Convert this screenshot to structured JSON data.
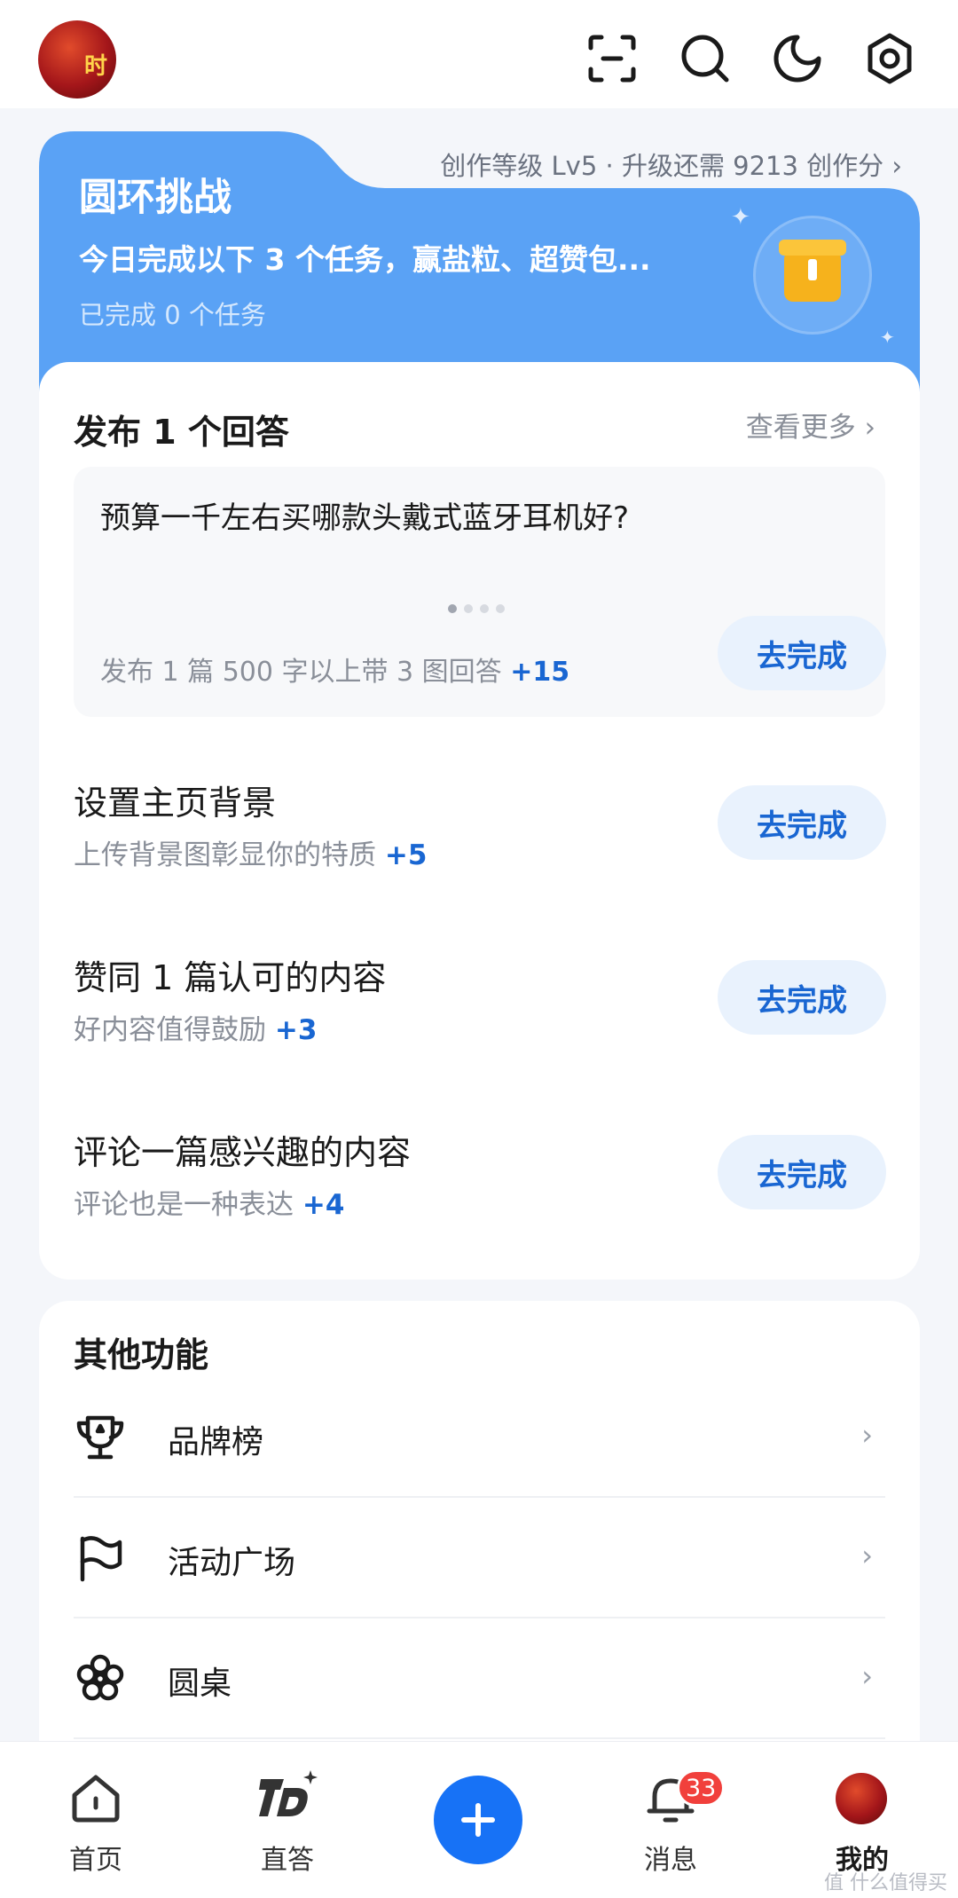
{
  "colors": {
    "brand_blue": "#1772f6",
    "challenge_blue": "#5aa2f5",
    "bonus_blue": "#1966d2",
    "badge_red": "#f1403c"
  },
  "topbar": {
    "avatar_text": "时",
    "icons": [
      "scan-icon",
      "search-icon",
      "moon-icon",
      "settings-icon"
    ]
  },
  "challenge": {
    "title": "圆环挑战",
    "level_text": "创作等级 Lv5 · 升级还需 9213 创作分 ›",
    "description": "今日完成以下 3 个任务，赢盐粒、超赞包...",
    "progress": "已完成 0 个任务"
  },
  "tasks": {
    "section_title": "发布 1 个回答",
    "see_more": "查看更多 ›",
    "question": {
      "text": "预算一千左右买哪款头戴式蓝牙耳机好?",
      "sub": "发布 1 篇 500 字以上带 3 图回答 ",
      "bonus": "+15",
      "button": "去完成"
    },
    "items": [
      {
        "title": "设置主页背景",
        "sub": "上传背景图彰显你的特质 ",
        "bonus": "+5",
        "button": "去完成"
      },
      {
        "title": "赞同 1 篇认可的内容",
        "sub": "好内容值得鼓励 ",
        "bonus": "+3",
        "button": "去完成"
      },
      {
        "title": "评论一篇感兴趣的内容",
        "sub": "评论也是一种表达 ",
        "bonus": "+4",
        "button": "去完成"
      }
    ]
  },
  "other": {
    "title": "其他功能",
    "rows": [
      {
        "label": "品牌榜",
        "icon": "trophy-icon"
      },
      {
        "label": "活动广场",
        "icon": "flag-icon"
      },
      {
        "label": "圆桌",
        "icon": "flower-icon"
      }
    ],
    "arrow": "›"
  },
  "bottomnav": {
    "items": [
      {
        "label": "首页",
        "icon": "home-icon"
      },
      {
        "label": "直答",
        "icon": "zhida-icon"
      },
      {
        "label": "",
        "icon": "plus-icon"
      },
      {
        "label": "消息",
        "icon": "bell-icon"
      },
      {
        "label": "我的",
        "icon": "avatar-icon"
      }
    ],
    "badge": "33"
  },
  "watermark": "值 什么值得买"
}
